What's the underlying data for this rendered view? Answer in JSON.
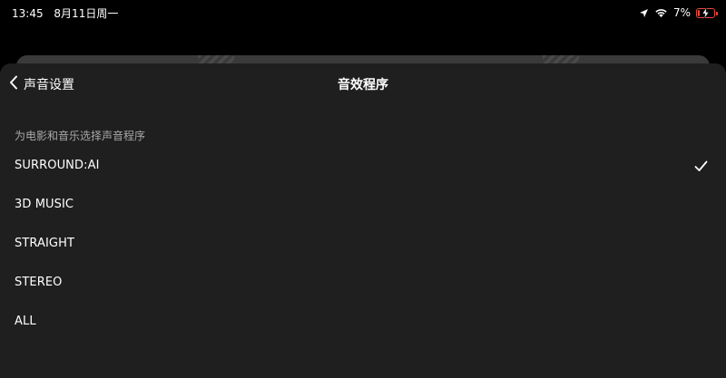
{
  "status_bar": {
    "time": "13:45",
    "date": "8月11日周一",
    "battery_percent": "7%",
    "battery_level": 0.07,
    "icons": [
      "location-arrow-icon",
      "wifi-icon",
      "battery-charging-icon"
    ],
    "battery_color": "#e84a3a"
  },
  "nav": {
    "back_label": "声音设置",
    "title": "音效程序"
  },
  "section": {
    "header": "为电影和音乐选择声音程序"
  },
  "options": [
    {
      "label": "SURROUND:AI",
      "selected": true
    },
    {
      "label": "3D MUSIC",
      "selected": false
    },
    {
      "label": "STRAIGHT",
      "selected": false
    },
    {
      "label": "STEREO",
      "selected": false
    },
    {
      "label": "ALL",
      "selected": false
    }
  ],
  "colors": {
    "background": "#000000",
    "sheet": "#1f1f1f",
    "text": "#ffffff",
    "secondary_text": "#a8a8a8"
  }
}
